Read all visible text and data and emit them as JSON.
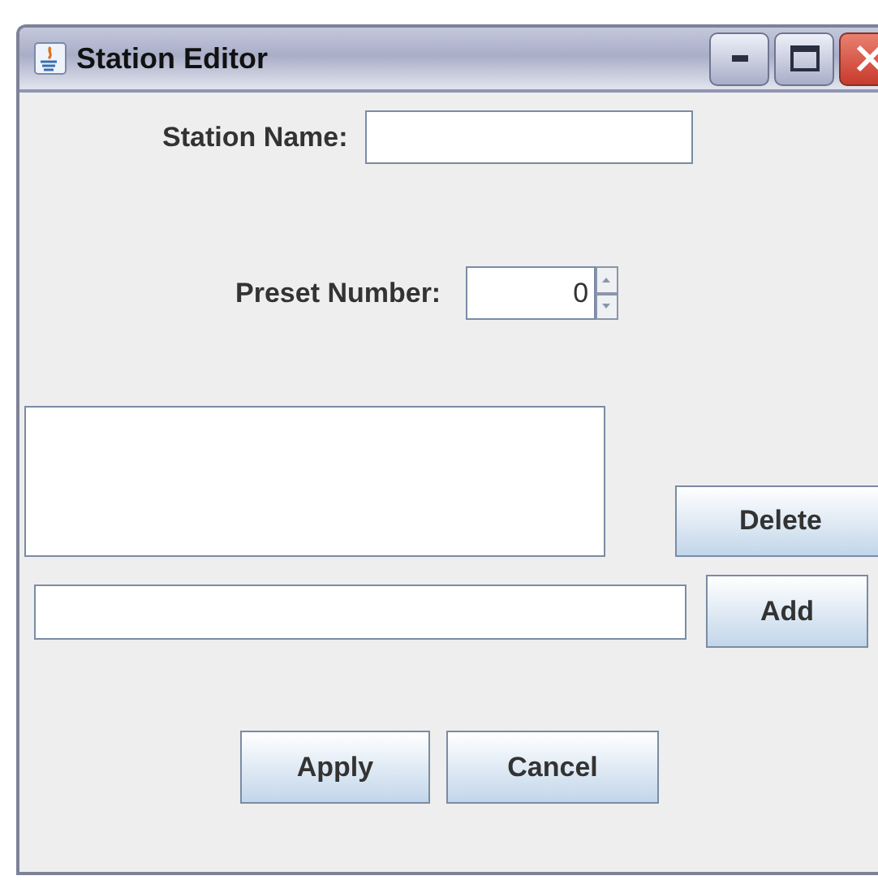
{
  "window": {
    "title": "Station Editor"
  },
  "station_name": {
    "label": "Station Name:"
  },
  "preset_number": {
    "label": "Preset Number:",
    "value": "0"
  },
  "list_buttons": {
    "delete": "Delete",
    "add": "Add"
  },
  "buttons": [
    "Apply",
    "Cancel"
  ]
}
